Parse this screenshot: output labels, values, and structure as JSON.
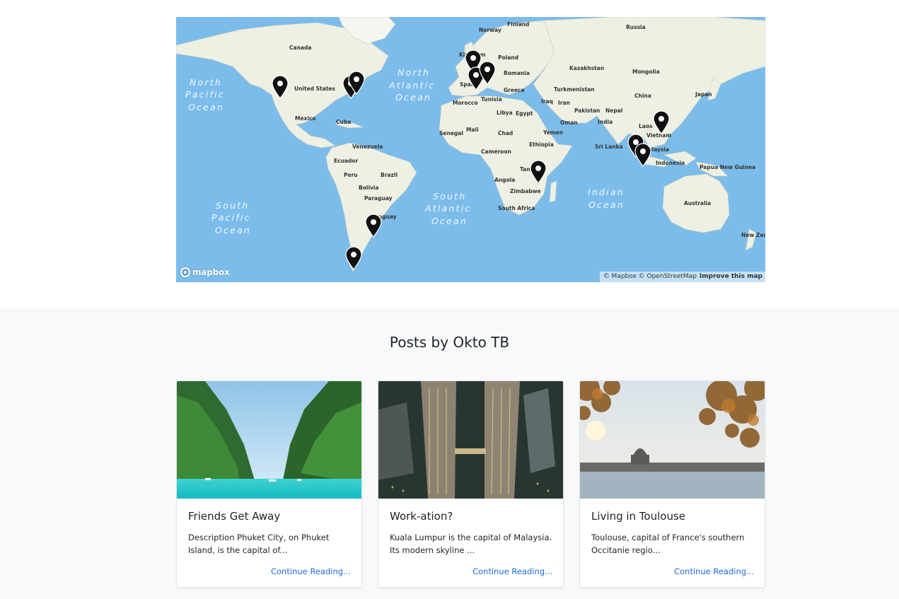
{
  "map": {
    "logo_text": "mapbox",
    "attribution": "© Mapbox © OpenStreetMap",
    "improve_link": "Improve this map",
    "labels": {
      "canada": "Canada",
      "united_states": "United States",
      "mexico": "Mexico",
      "cuba": "Cuba",
      "venezuela": "Venezuela",
      "ecuador": "Ecuador",
      "peru": "Peru",
      "brazil": "Brazil",
      "bolivia": "Bolivia",
      "paraguay": "Paraguay",
      "uruguay": "Uruguay",
      "norway": "Norway",
      "finland": "Finland",
      "russia": "Russia",
      "kingdom": "Kingdom",
      "poland": "Poland",
      "romania": "Romania",
      "spain": "Spain",
      "greece": "Greece",
      "morocco": "Morocco",
      "tunisia": "Tunisia",
      "libya": "Libya",
      "egypt": "Egypt",
      "senegal": "Senegal",
      "mali": "Mali",
      "chad": "Chad",
      "cameroon": "Cameroon",
      "ethiopia": "Ethiopia",
      "tanzania": "Tanzania",
      "angola": "Angola",
      "zimbabwe": "Zimbabwe",
      "south_africa": "South Africa",
      "kazakhstan": "Kazakhstan",
      "mongolia": "Mongolia",
      "turkmenistan": "Turkmenistan",
      "iraq": "Iraq",
      "iran": "Iran",
      "pakistan": "Pakistan",
      "nepal": "Nepal",
      "india": "India",
      "oman": "Oman",
      "yemen": "Yemen",
      "china": "China",
      "japan": "Japan",
      "laos": "Laos",
      "vietnam": "Vietnam",
      "sri_lanka": "Sri Lanka",
      "malaysia": "Malaysia",
      "indonesia": "Indonesia",
      "papua": "Papua New Guinea",
      "australia": "Australia",
      "new_zealand": "New Zeal",
      "north_pacific": "North Pacific Ocean",
      "north_atlantic": "North Atlantic Ocean",
      "south_pacific": "South Pacific Ocean",
      "south_atlantic": "South Atlantic Ocean",
      "indian_ocean": "Indian Ocean"
    },
    "marker_icon": "map-pin-icon"
  },
  "posts": {
    "title": "Posts by Okto TB",
    "cards": [
      {
        "title": "Friends Get Away",
        "excerpt": "Description Phuket City, on Phuket Island, is the capital of...",
        "link": "Continue Reading..."
      },
      {
        "title": "Work-ation?",
        "excerpt": "Kuala Lumpur is the capital of Malaysia. Its modern skyline ...",
        "link": "Continue Reading..."
      },
      {
        "title": "Living in Toulouse",
        "excerpt": "Toulouse, capital of France's southern Occitanie regio...",
        "link": "Continue Reading..."
      }
    ]
  },
  "colors": {
    "ocean": "#7cbceb",
    "land": "#eef0e3",
    "link": "#1e6bd6",
    "section_bg": "#f8f9fa"
  }
}
